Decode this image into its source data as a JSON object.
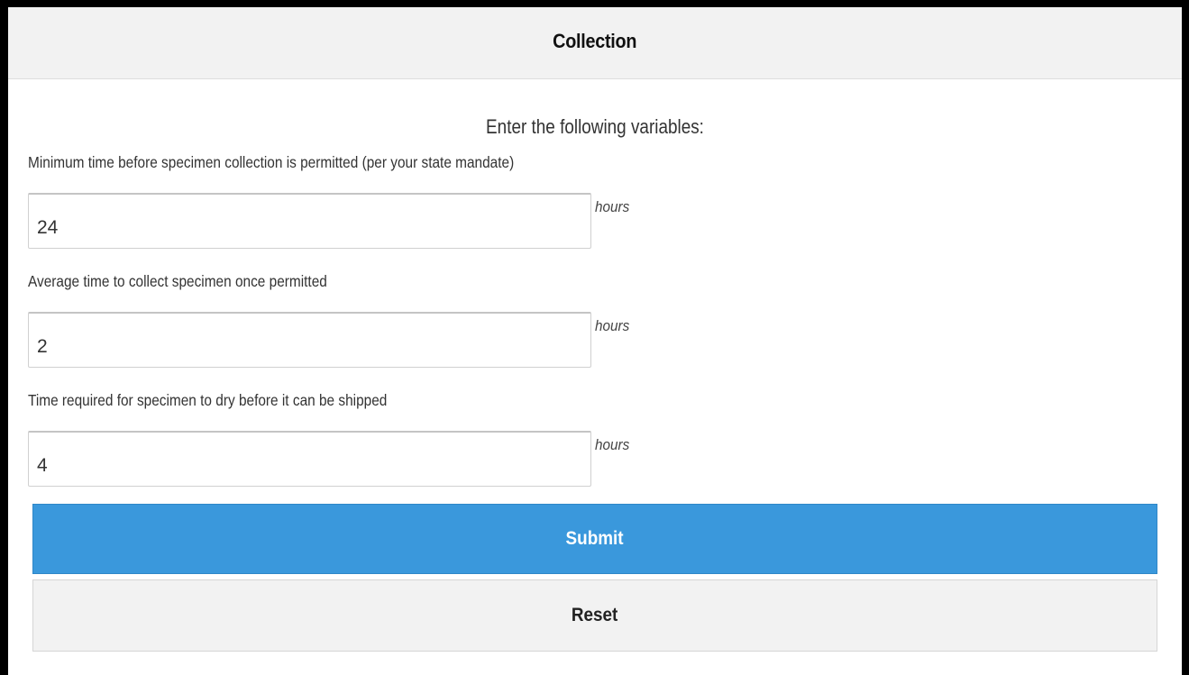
{
  "header": {
    "title": "Collection"
  },
  "intro": "Enter the following variables:",
  "fields": [
    {
      "label": "Minimum time before specimen collection is permitted (per your state mandate)",
      "value": "24",
      "unit": "hours"
    },
    {
      "label": "Average time to collect specimen once permitted",
      "value": "2",
      "unit": "hours"
    },
    {
      "label": "Time required for specimen to dry before it can be shipped",
      "value": "4",
      "unit": "hours"
    }
  ],
  "actions": {
    "submit_label": "Submit",
    "reset_label": "Reset"
  },
  "colors": {
    "primary": "#3a98dc",
    "header_bg": "#f2f2f2",
    "frame": "#000000"
  }
}
